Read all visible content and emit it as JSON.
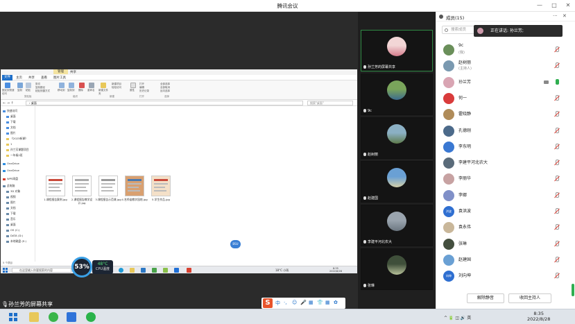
{
  "window": {
    "title": "腾讯会议",
    "minimize": "—",
    "maximize": "□",
    "close": "✕"
  },
  "shared_screen": {
    "ribbon_tabs": [
      "管理",
      "共享"
    ],
    "menu": [
      "文件",
      "主页",
      "共享",
      "查看",
      "图片工具"
    ],
    "ribbon": {
      "pin": "固定到快速访问",
      "copy": "复制",
      "paste": "粘贴",
      "cut": "剪切",
      "copy_path": "复制路径",
      "paste_shortcut": "粘贴快捷方式",
      "move_to": "移动到",
      "copy_to": "复制到",
      "delete": "删除",
      "rename": "重命名",
      "new_folder": "新建文件夹",
      "new_item": "新建项目",
      "easy_access": "轻松访问",
      "properties": "属性",
      "open": "打开",
      "edit": "编辑",
      "history": "历史记录",
      "select_all": "全部选择",
      "select_none": "全部取消",
      "invert": "反向选择",
      "groups": [
        "剪贴板",
        "组织",
        "新建",
        "打开",
        "选择"
      ]
    },
    "address": "› 桌面",
    "search_placeholder": "搜索\"桌面\"",
    "nav": [
      "快速访问",
      "桌面",
      "下载",
      "文档",
      "图片",
      "《2023新课》",
      "1",
      "孙兰芳课题项目",
      "一年级2班",
      "OneDrive",
      "OneDrive",
      "WPS网盘",
      "此电脑",
      "3D 对象",
      "视频",
      "图片",
      "文档",
      "下载",
      "音乐",
      "桌面",
      "OS (C:)",
      "DATA (D:)",
      "本地磁盘 (E:)"
    ],
    "files": [
      {
        "name": "1.课程报告案例.jpg"
      },
      {
        "name": "2.课程报告教学设计.jpg"
      },
      {
        "name": "3.课程报告示范课.jpg"
      },
      {
        "name": "4.名师谈教学园地.jpg"
      },
      {
        "name": "5.学生作品.jpg"
      }
    ],
    "status": "5 个项目",
    "search_box": "在这里输入你要搜索的内容",
    "weather": "18°C 小雨",
    "time": "8:35",
    "date": "2022/8/28"
  },
  "cpu": {
    "percent": "53%",
    "temp": "48°C",
    "label": "CPU温度"
  },
  "share_label": "孙兰芳的屏幕共享",
  "ime": {
    "logo": "S",
    "items": [
      "中",
      "·,",
      "☺",
      "🎤",
      "▦",
      "👕",
      "▦",
      "✿"
    ]
  },
  "bubble_text": "BSU",
  "tiles": [
    {
      "name": "孙兰芳的屏幕共享",
      "colorA": "#f2d6d6",
      "colorB": "#d47b8b"
    },
    {
      "name": "9c",
      "colorA": "#7aa55b",
      "colorB": "#3b6a8e"
    },
    {
      "name": "赵树丽",
      "colorA": "#8bb0c4",
      "colorB": "#5d7a4a"
    },
    {
      "name": "赵建国",
      "colorA": "#6aa0d4",
      "colorB": "#d4d0a8"
    },
    {
      "name": "李建平河北农大",
      "colorA": "#9aa4ae",
      "colorB": "#6b7680"
    },
    {
      "name": "张琳",
      "colorA": "#3f4f3a",
      "colorB": "#b8c29a"
    }
  ],
  "members": {
    "title": "成员(15)",
    "more": "···",
    "close": "✕",
    "search_placeholder": "搜索成员",
    "speaking": "正在讲话: 孙兰芳;",
    "list": [
      {
        "name": "9c",
        "sub": "(我)",
        "color": "#6a8f5a",
        "initials": ""
      },
      {
        "name": "赵树丽",
        "sub": "(主持人)",
        "color": "#7a99b0",
        "initials": ""
      },
      {
        "name": "孙兰芳",
        "sub": "",
        "color": "#d9a5b3",
        "initials": ""
      },
      {
        "name": "何一",
        "sub": "",
        "color": "#d93b3b",
        "initials": ""
      },
      {
        "name": "霍晓静",
        "sub": "",
        "color": "#b08c5a",
        "initials": ""
      },
      {
        "name": "孔德刚",
        "sub": "",
        "color": "#4c6a8a",
        "initials": ""
      },
      {
        "name": "李东明",
        "sub": "",
        "color": "#3a78d2",
        "initials": ""
      },
      {
        "name": "李建平河北农大",
        "sub": "",
        "color": "#5a6b7a",
        "initials": ""
      },
      {
        "name": "李丽华",
        "sub": "",
        "color": "#c7a2a2",
        "initials": ""
      },
      {
        "name": "李娜",
        "sub": "",
        "color": "#8090c8",
        "initials": ""
      },
      {
        "name": "袁洪波",
        "sub": "",
        "color": "#2f6fd1",
        "initials": "洪波"
      },
      {
        "name": "袁永伟",
        "sub": "",
        "color": "#c9b79a",
        "initials": ""
      },
      {
        "name": "张琳",
        "sub": "",
        "color": "#444f3f",
        "initials": ""
      },
      {
        "name": "赵建国",
        "sub": "",
        "color": "#6aa0d4",
        "initials": ""
      },
      {
        "name": "刘向坤",
        "sub": "",
        "color": "#2f6fd1",
        "initials": "向坤"
      }
    ],
    "mute_all": "解除静音",
    "reclaim_host": "收回主持人"
  },
  "os_taskbar": {
    "time": "8:35",
    "date": "2022/8/28",
    "tray": "^ 🔋 ◫ 🔊 英"
  }
}
